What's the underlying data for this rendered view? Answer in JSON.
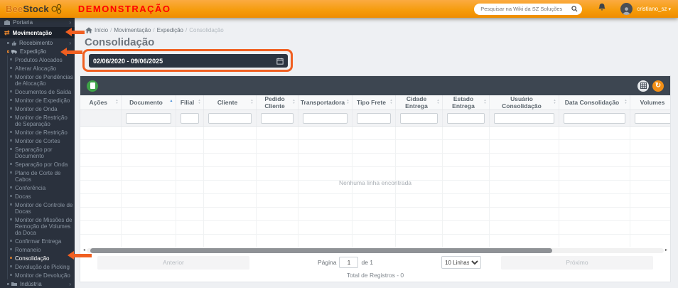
{
  "topbar": {
    "logo_primary": "Bee",
    "logo_secondary": "Stock",
    "demo_banner": "DEMONSTRAÇÃO",
    "search_placeholder": "Pesquisar na Wiki da SZ Soluções",
    "username": "cristiano_sz"
  },
  "breadcrumb": {
    "separator": "/",
    "items": [
      "Início",
      "Movimentação",
      "Expedição",
      "Consolidação"
    ]
  },
  "page": {
    "title": "Consolidação",
    "date_range": "02/06/2020 - 09/06/2025"
  },
  "sidebar": {
    "items": [
      {
        "label": "Portaria"
      },
      {
        "label": "Movimentação",
        "active": true
      },
      {
        "label": "Recebimento"
      },
      {
        "label": "Expedição",
        "expanded": true
      },
      {
        "label": "Produtos Alocados"
      },
      {
        "label": "Alterar Alocação"
      },
      {
        "label": "Monitor de Pendências de Alocação"
      },
      {
        "label": "Documentos de Saída"
      },
      {
        "label": "Monitor de Expedição"
      },
      {
        "label": "Monitor de Onda"
      },
      {
        "label": "Monitor de Restrição de Separação"
      },
      {
        "label": "Monitor de Restrição"
      },
      {
        "label": "Monitor de Cortes"
      },
      {
        "label": "Separação por Documento"
      },
      {
        "label": "Separação por Onda"
      },
      {
        "label": "Plano de Corte de Cabos"
      },
      {
        "label": "Conferência"
      },
      {
        "label": "Docas"
      },
      {
        "label": "Monitor de Controle de Docas"
      },
      {
        "label": "Monitor de Missões de Remoção de Volumes da Doca"
      },
      {
        "label": "Confirmar Entrega"
      },
      {
        "label": "Romaneio"
      },
      {
        "label": "Consolidação",
        "active": true
      },
      {
        "label": "Devolução de Picking"
      },
      {
        "label": "Monitor de Devolução"
      },
      {
        "label": "Indústria"
      }
    ]
  },
  "table": {
    "columns": [
      {
        "label": "Ações"
      },
      {
        "label": "Documento",
        "sorted": "asc"
      },
      {
        "label": "Filial"
      },
      {
        "label": "Cliente"
      },
      {
        "label": "Pedido Cliente"
      },
      {
        "label": "Transportadora"
      },
      {
        "label": "Tipo Frete"
      },
      {
        "label": "Cidade Entrega"
      },
      {
        "label": "Estado Entrega"
      },
      {
        "label": "Usuário Consolidação"
      },
      {
        "label": "Data Consolidação"
      },
      {
        "label": "Volumes"
      }
    ],
    "empty_row_count": 9,
    "empty_message": "Nenhuma linha encontrada",
    "toolbar_icons": [
      "excel-export",
      "column-chooser",
      "refresh"
    ]
  },
  "pagination": {
    "previous_label": "Anterior",
    "page_label": "Página",
    "page_value": "1",
    "of_label": "de 1",
    "rows_per_page": "10 Linhas",
    "next_label": "Próximo",
    "total_label": "Total de Registros - 0"
  },
  "colors": {
    "topbar_orange": "#f59b0a",
    "demo_red": "#ff0000",
    "sidebar_bg": "#2a313d",
    "toolbar_bg": "#3d4651",
    "excel_green": "#3fa348",
    "refresh_orange": "#f28f16",
    "sort_active_blue": "#4a90d9",
    "annotation_orange": "#f05f21"
  }
}
